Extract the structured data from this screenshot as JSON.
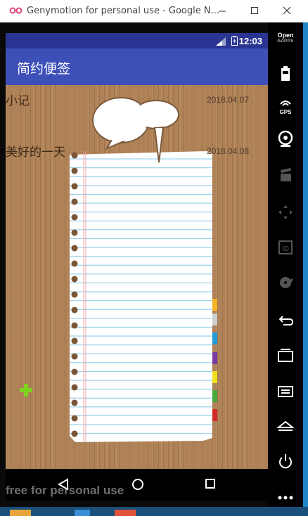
{
  "window": {
    "title": "Genymotion for personal use - Google N...",
    "icon": "genymotion-icon"
  },
  "status_bar": {
    "time": "12:03"
  },
  "app_bar": {
    "title": "简约便签"
  },
  "notes": [
    {
      "title": "小记",
      "date": "2018.04.07"
    },
    {
      "title": "美好的一天",
      "date": "2018.04.08"
    }
  ],
  "sidebar": {
    "opengapps_line1": "Open",
    "opengapps_line2": "GAPPS",
    "gps_label": "GPS",
    "id_label": "ID"
  },
  "watermark": "free for personal use",
  "colors": {
    "app_bar": "#3c50b8",
    "status_bar": "#2a3593",
    "wood": "#b08257",
    "add_button": "#7ed321"
  }
}
